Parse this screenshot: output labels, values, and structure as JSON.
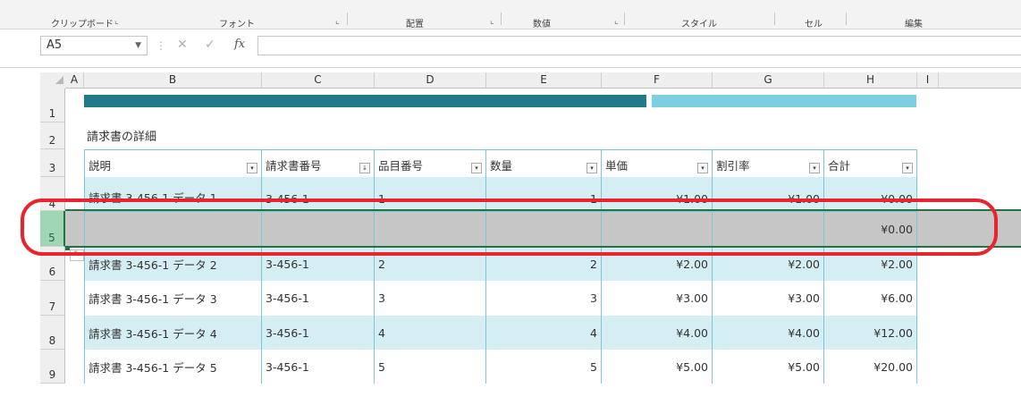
{
  "ribbon": {
    "groups": [
      {
        "label": "クリップボード"
      },
      {
        "label": "フォント"
      },
      {
        "label": "配置"
      },
      {
        "label": "数値"
      },
      {
        "label": "スタイル"
      },
      {
        "label": "セル"
      },
      {
        "label": "編集"
      }
    ],
    "launcher_icon": "dialog-launcher-icon"
  },
  "formula_bar": {
    "name_box": "A5",
    "formula": "",
    "icons": [
      "cancel-icon",
      "enter-icon",
      "function-icon"
    ],
    "fx_label": "fx"
  },
  "columns": [
    "A",
    "B",
    "C",
    "D",
    "E",
    "F",
    "G",
    "H",
    "I"
  ],
  "rows": [
    "1",
    "2",
    "3",
    "4",
    "5",
    "6",
    "7",
    "8",
    "9"
  ],
  "selected_row": "5",
  "colors": {
    "bar_dark": "#217a8a",
    "bar_light": "#7ccfe0",
    "band": "#d5eef3",
    "selected_row_fill": "#c6c6c6",
    "highlight": "#e8252e",
    "selection_green": "#217346"
  },
  "sheet": {
    "title": "請求書の詳細",
    "headers": [
      "説明",
      "請求書番号",
      "品目番号",
      "数量",
      "単価",
      "割引率",
      "合計"
    ],
    "data_rows": [
      {
        "row": "4",
        "cells": [
          "請求書 3-456-1 データ 1",
          "3-456-1",
          "1",
          "1",
          "¥1.00",
          "¥1.00",
          "¥0.00"
        ]
      },
      {
        "row": "5",
        "cells": [
          "",
          "",
          "",
          "",
          "",
          "",
          "¥0.00"
        ]
      },
      {
        "row": "6",
        "cells": [
          "請求書 3-456-1 データ 2",
          "3-456-1",
          "2",
          "2",
          "¥2.00",
          "¥2.00",
          "¥2.00"
        ]
      },
      {
        "row": "7",
        "cells": [
          "請求書 3-456-1 データ 3",
          "3-456-1",
          "3",
          "3",
          "¥3.00",
          "¥3.00",
          "¥6.00"
        ]
      },
      {
        "row": "8",
        "cells": [
          "請求書 3-456-1 データ 4",
          "3-456-1",
          "4",
          "4",
          "¥4.00",
          "¥4.00",
          "¥12.00"
        ]
      },
      {
        "row": "9",
        "cells": [
          "請求書 3-456-1 データ 5",
          "3-456-1",
          "5",
          "5",
          "¥5.00",
          "¥5.00",
          "¥20.00"
        ]
      }
    ]
  }
}
